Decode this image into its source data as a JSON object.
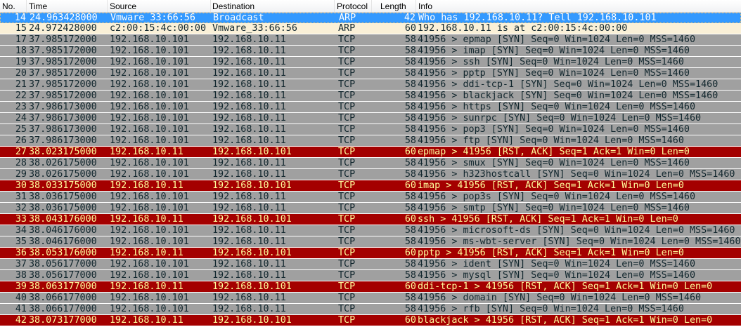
{
  "columns": {
    "no": "No.",
    "time": "Time",
    "source": "Source",
    "destination": "Destination",
    "protocol": "Protocol",
    "length": "Length",
    "info": "Info"
  },
  "colors": {
    "selected": "#3399ff",
    "arp": "#faf0d7",
    "tcp": "#a0a0a0",
    "rst": "#a40000",
    "rst_text": "#fffc9c"
  },
  "packets": [
    {
      "no": "14",
      "time": "24.963428000",
      "source": "Vmware_33:66:56",
      "destination": "Broadcast",
      "protocol": "ARP",
      "length": "42",
      "info": "Who has 192.168.10.11?  Tell 192.168.10.101",
      "style": "selected"
    },
    {
      "no": "15",
      "time": "24.972428000",
      "source": "c2:00:15:4c:00:00",
      "destination": "Vmware_33:66:56",
      "protocol": "ARP",
      "length": "60",
      "info": "192.168.10.11 is at c2:00:15:4c:00:00",
      "style": "arp"
    },
    {
      "no": "17",
      "time": "37.985172000",
      "source": "192.168.10.101",
      "destination": "192.168.10.11",
      "protocol": "TCP",
      "length": "58",
      "info": "41956 > epmap [SYN] Seq=0 Win=1024 Len=0 MSS=1460",
      "style": "tcp"
    },
    {
      "no": "18",
      "time": "37.985172000",
      "source": "192.168.10.101",
      "destination": "192.168.10.11",
      "protocol": "TCP",
      "length": "58",
      "info": "41956 > imap [SYN] Seq=0 Win=1024 Len=0 MSS=1460",
      "style": "tcp"
    },
    {
      "no": "19",
      "time": "37.985172000",
      "source": "192.168.10.101",
      "destination": "192.168.10.11",
      "protocol": "TCP",
      "length": "58",
      "info": "41956 > ssh [SYN] Seq=0 Win=1024 Len=0 MSS=1460",
      "style": "tcp"
    },
    {
      "no": "20",
      "time": "37.985172000",
      "source": "192.168.10.101",
      "destination": "192.168.10.11",
      "protocol": "TCP",
      "length": "58",
      "info": "41956 > pptp [SYN] Seq=0 Win=1024 Len=0 MSS=1460",
      "style": "tcp"
    },
    {
      "no": "21",
      "time": "37.985172000",
      "source": "192.168.10.101",
      "destination": "192.168.10.11",
      "protocol": "TCP",
      "length": "58",
      "info": "41956 > ddi-tcp-1 [SYN] Seq=0 Win=1024 Len=0 MSS=1460",
      "style": "tcp"
    },
    {
      "no": "22",
      "time": "37.985172000",
      "source": "192.168.10.101",
      "destination": "192.168.10.11",
      "protocol": "TCP",
      "length": "58",
      "info": "41956 > blackjack [SYN] Seq=0 Win=1024 Len=0 MSS=1460",
      "style": "tcp"
    },
    {
      "no": "23",
      "time": "37.986173000",
      "source": "192.168.10.101",
      "destination": "192.168.10.11",
      "protocol": "TCP",
      "length": "58",
      "info": "41956 > https [SYN] Seq=0 Win=1024 Len=0 MSS=1460",
      "style": "tcp"
    },
    {
      "no": "24",
      "time": "37.986173000",
      "source": "192.168.10.101",
      "destination": "192.168.10.11",
      "protocol": "TCP",
      "length": "58",
      "info": "41956 > sunrpc [SYN] Seq=0 Win=1024 Len=0 MSS=1460",
      "style": "tcp"
    },
    {
      "no": "25",
      "time": "37.986173000",
      "source": "192.168.10.101",
      "destination": "192.168.10.11",
      "protocol": "TCP",
      "length": "58",
      "info": "41956 > pop3 [SYN] Seq=0 Win=1024 Len=0 MSS=1460",
      "style": "tcp"
    },
    {
      "no": "26",
      "time": "37.986173000",
      "source": "192.168.10.101",
      "destination": "192.168.10.11",
      "protocol": "TCP",
      "length": "58",
      "info": "41956 > ftp [SYN] Seq=0 Win=1024 Len=0 MSS=1460",
      "style": "tcp"
    },
    {
      "no": "27",
      "time": "38.023175000",
      "source": "192.168.10.11",
      "destination": "192.168.10.101",
      "protocol": "TCP",
      "length": "60",
      "info": "epmap > 41956 [RST, ACK] Seq=1 Ack=1 Win=0 Len=0",
      "style": "rst"
    },
    {
      "no": "28",
      "time": "38.026175000",
      "source": "192.168.10.101",
      "destination": "192.168.10.11",
      "protocol": "TCP",
      "length": "58",
      "info": "41956 > smux [SYN] Seq=0 Win=1024 Len=0 MSS=1460",
      "style": "tcp"
    },
    {
      "no": "29",
      "time": "38.026175000",
      "source": "192.168.10.101",
      "destination": "192.168.10.11",
      "protocol": "TCP",
      "length": "58",
      "info": "41956 > h323hostcall [SYN] Seq=0 Win=1024 Len=0 MSS=1460",
      "style": "tcp"
    },
    {
      "no": "30",
      "time": "38.033175000",
      "source": "192.168.10.11",
      "destination": "192.168.10.101",
      "protocol": "TCP",
      "length": "60",
      "info": "imap > 41956 [RST, ACK] Seq=1 Ack=1 Win=0 Len=0",
      "style": "rst"
    },
    {
      "no": "31",
      "time": "38.036175000",
      "source": "192.168.10.101",
      "destination": "192.168.10.11",
      "protocol": "TCP",
      "length": "58",
      "info": "41956 > pop3s [SYN] Seq=0 Win=1024 Len=0 MSS=1460",
      "style": "tcp"
    },
    {
      "no": "32",
      "time": "38.036175000",
      "source": "192.168.10.101",
      "destination": "192.168.10.11",
      "protocol": "TCP",
      "length": "58",
      "info": "41956 > smtp [SYN] Seq=0 Win=1024 Len=0 MSS=1460",
      "style": "tcp"
    },
    {
      "no": "33",
      "time": "38.043176000",
      "source": "192.168.10.11",
      "destination": "192.168.10.101",
      "protocol": "TCP",
      "length": "60",
      "info": "ssh > 41956 [RST, ACK] Seq=1 Ack=1 Win=0 Len=0",
      "style": "rst"
    },
    {
      "no": "34",
      "time": "38.046176000",
      "source": "192.168.10.101",
      "destination": "192.168.10.11",
      "protocol": "TCP",
      "length": "58",
      "info": "41956 > microsoft-ds [SYN] Seq=0 Win=1024 Len=0 MSS=1460",
      "style": "tcp"
    },
    {
      "no": "35",
      "time": "38.046176000",
      "source": "192.168.10.101",
      "destination": "192.168.10.11",
      "protocol": "TCP",
      "length": "58",
      "info": "41956 > ms-wbt-server [SYN] Seq=0 Win=1024 Len=0 MSS=1460",
      "style": "tcp"
    },
    {
      "no": "36",
      "time": "38.053176000",
      "source": "192.168.10.11",
      "destination": "192.168.10.101",
      "protocol": "TCP",
      "length": "60",
      "info": "pptp > 41956 [RST, ACK] Seq=1 Ack=1 Win=0 Len=0",
      "style": "rst"
    },
    {
      "no": "37",
      "time": "38.056177000",
      "source": "192.168.10.101",
      "destination": "192.168.10.11",
      "protocol": "TCP",
      "length": "58",
      "info": "41956 > ident [SYN] Seq=0 Win=1024 Len=0 MSS=1460",
      "style": "tcp"
    },
    {
      "no": "38",
      "time": "38.056177000",
      "source": "192.168.10.101",
      "destination": "192.168.10.11",
      "protocol": "TCP",
      "length": "58",
      "info": "41956 > mysql [SYN] Seq=0 Win=1024 Len=0 MSS=1460",
      "style": "tcp"
    },
    {
      "no": "39",
      "time": "38.063177000",
      "source": "192.168.10.11",
      "destination": "192.168.10.101",
      "protocol": "TCP",
      "length": "60",
      "info": "ddi-tcp-1 > 41956 [RST, ACK] Seq=1 Ack=1 Win=0 Len=0",
      "style": "rst"
    },
    {
      "no": "40",
      "time": "38.066177000",
      "source": "192.168.10.101",
      "destination": "192.168.10.11",
      "protocol": "TCP",
      "length": "58",
      "info": "41956 > domain [SYN] Seq=0 Win=1024 Len=0 MSS=1460",
      "style": "tcp"
    },
    {
      "no": "41",
      "time": "38.066177000",
      "source": "192.168.10.101",
      "destination": "192.168.10.11",
      "protocol": "TCP",
      "length": "58",
      "info": "41956 > rfb [SYN] Seq=0 Win=1024 Len=0 MSS=1460",
      "style": "tcp"
    },
    {
      "no": "42",
      "time": "38.073177000",
      "source": "192.168.10.11",
      "destination": "192.168.10.101",
      "protocol": "TCP",
      "length": "60",
      "info": "blackjack > 41956 [RST, ACK] Seq=1 Ack=1 Win=0 Len=0",
      "style": "rst"
    }
  ]
}
